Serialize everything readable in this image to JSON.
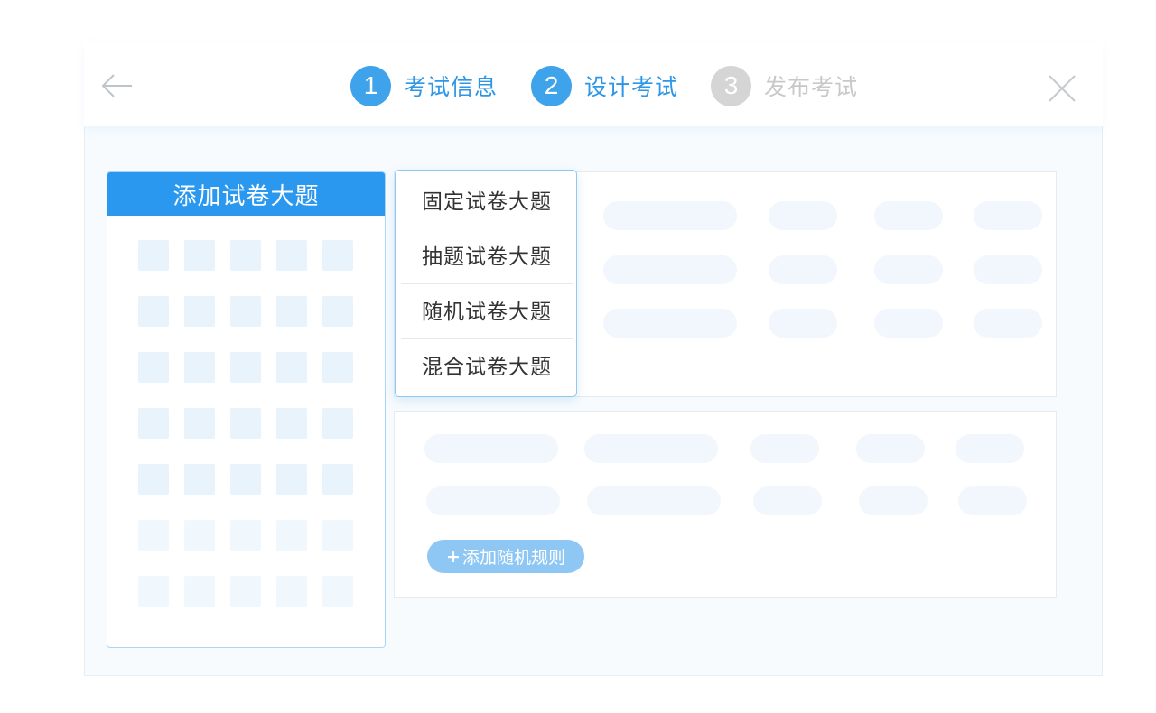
{
  "steps": [
    {
      "number": "1",
      "label": "考试信息",
      "state": "active"
    },
    {
      "number": "2",
      "label": "设计考试",
      "state": "active"
    },
    {
      "number": "3",
      "label": "发布考试",
      "state": "inactive"
    }
  ],
  "left_panel": {
    "title": "添加试卷大题"
  },
  "dropdown": {
    "options": [
      "固定试卷大题",
      "抽题试卷大题",
      "随机试卷大题",
      "混合试卷大题"
    ]
  },
  "add_rule": {
    "plus": "+",
    "label": "添加随机规则"
  },
  "colors": {
    "accent": "#2a98ef",
    "step_active": "#3fa3ec",
    "step_inactive": "#d5d5d5",
    "add_button": "#8ec7f4"
  },
  "icons": {
    "back": "arrow-left-icon",
    "close": "close-icon"
  }
}
